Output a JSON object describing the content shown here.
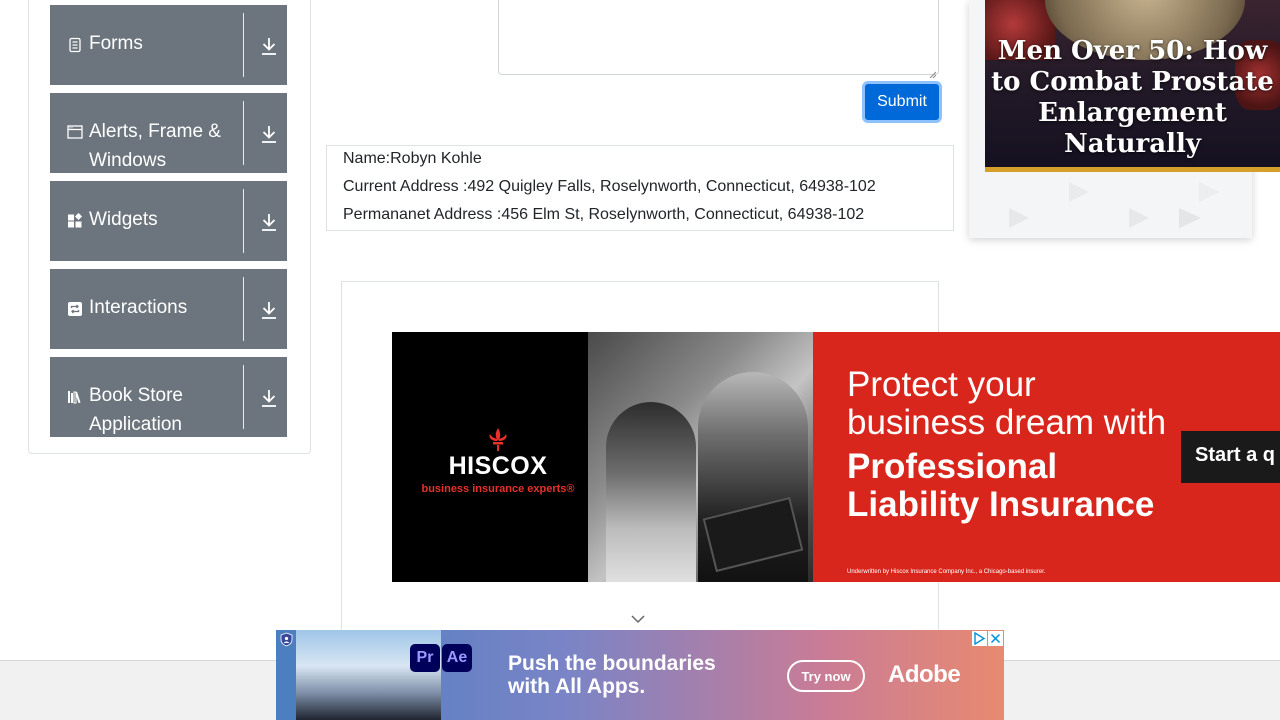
{
  "sidebar": {
    "groups": [
      {
        "label": "Forms",
        "icon": "forms-icon"
      },
      {
        "label": "Alerts, Frame & Windows",
        "icon": "window-icon"
      },
      {
        "label": "Widgets",
        "icon": "widgets-icon"
      },
      {
        "label": "Interactions",
        "icon": "interactions-icon"
      },
      {
        "label": "Book Store Application",
        "icon": "bookstore-icon"
      }
    ]
  },
  "form": {
    "submit_label": "Submit"
  },
  "output": {
    "name": "Name:Robyn Kohle",
    "current_address": "Current Address :492 Quigley Falls, Roselynworth, Connecticut, 64938-102",
    "permanent_address": "Permananet Address :456 Elm St, Roselynworth, Connecticut, 64938-102"
  },
  "ads": {
    "right": {
      "headline": "Men Over 50: How to Combat Prostate Enlargement Naturally"
    },
    "hiscox": {
      "brand": "HISCOX",
      "tagline": "business insurance experts®",
      "line1": "Protect your",
      "line2": "business dream with",
      "line3": "Professional",
      "line4": "Liability Insurance",
      "fine_print": "Underwritten by Hiscox Insurance Company Inc., a Chicago-based insurer.",
      "cta": "Start a q"
    },
    "adobe": {
      "pr": "Pr",
      "ae": "Ae",
      "line1": "Push the boundaries",
      "line2": "with All Apps.",
      "cta": "Try now",
      "logo": "Adobe"
    }
  },
  "colors": {
    "sidebar_header": "#6c757d",
    "primary": "#0069d9",
    "hiscox_red": "#d9261c"
  }
}
